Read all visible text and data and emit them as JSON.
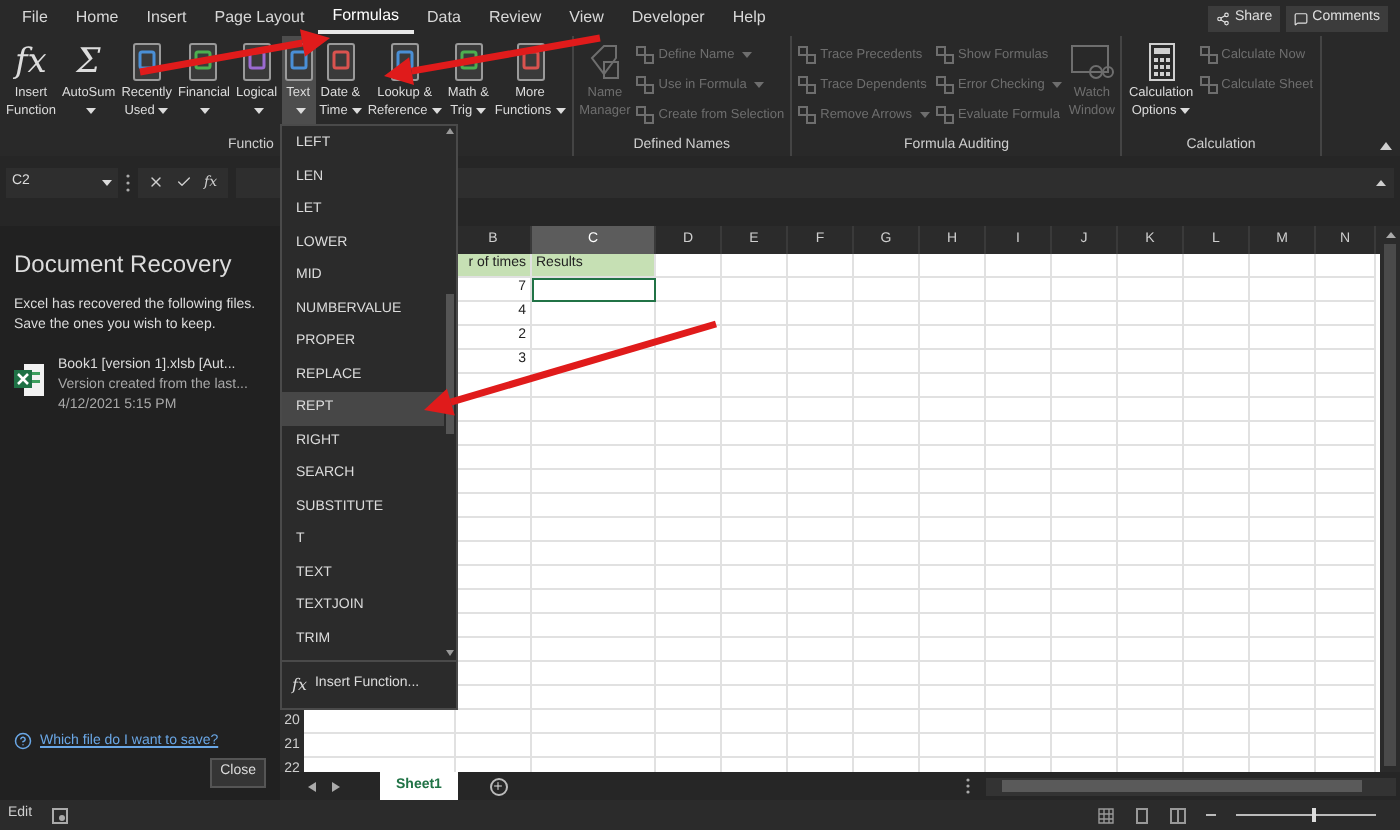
{
  "menu_tabs": [
    {
      "label": "File",
      "selected": false
    },
    {
      "label": "Home",
      "selected": false
    },
    {
      "label": "Insert",
      "selected": false
    },
    {
      "label": "Page Layout",
      "selected": false
    },
    {
      "label": "Formulas",
      "selected": true
    },
    {
      "label": "Data",
      "selected": false
    },
    {
      "label": "Review",
      "selected": false
    },
    {
      "label": "View",
      "selected": false
    },
    {
      "label": "Developer",
      "selected": false
    },
    {
      "label": "Help",
      "selected": false
    }
  ],
  "share_button": "Share",
  "comments_button": "Comments",
  "ribbon_groups": [
    {
      "label": "Functio",
      "buttons": [
        {
          "kind": "large",
          "glyph": "fx",
          "lines": [
            "Insert",
            "Function"
          ],
          "caret": false,
          "selected": false,
          "disabled": false
        },
        {
          "kind": "large",
          "glyph": "Σ",
          "lines": [
            "AutoSum"
          ],
          "caret": true,
          "selected": false,
          "disabled": false
        },
        {
          "kind": "large",
          "lines": [
            "Recently",
            "Used"
          ],
          "caret": true,
          "selected": false,
          "disabled": false
        },
        {
          "kind": "large",
          "lines": [
            "Financial"
          ],
          "caret": true,
          "selected": false,
          "disabled": false
        },
        {
          "kind": "large",
          "lines": [
            "Logical"
          ],
          "caret": true,
          "selected": false,
          "disabled": false
        },
        {
          "kind": "large",
          "lines": [
            "Text"
          ],
          "caret": true,
          "selected": true,
          "disabled": false
        },
        {
          "kind": "large",
          "lines": [
            "Date &",
            "Time"
          ],
          "caret": true,
          "selected": false,
          "disabled": false
        },
        {
          "kind": "large",
          "lines": [
            "Lookup &",
            "Reference"
          ],
          "caret": true,
          "selected": false,
          "disabled": false
        },
        {
          "kind": "large",
          "lines": [
            "Math &",
            "Trig"
          ],
          "caret": true,
          "selected": false,
          "disabled": false
        },
        {
          "kind": "large",
          "lines": [
            "More",
            "Functions"
          ],
          "caret": true,
          "selected": false,
          "disabled": false
        }
      ]
    },
    {
      "label": "Defined Names",
      "buttons": [
        {
          "kind": "large",
          "lines": [
            "Name",
            "Manager"
          ],
          "caret": false,
          "selected": false,
          "disabled": true
        },
        {
          "kind": "small",
          "label": "Define Name",
          "caret": true,
          "selected": false,
          "disabled": true
        },
        {
          "kind": "small",
          "label": "Use in Formula",
          "caret": true,
          "selected": false,
          "disabled": true
        },
        {
          "kind": "small",
          "label": "Create from Selection",
          "caret": false,
          "selected": false,
          "disabled": true
        }
      ]
    },
    {
      "label": "Formula Auditing",
      "buttons": [
        {
          "kind": "small",
          "label": "Trace Precedents",
          "caret": false,
          "selected": false,
          "disabled": true
        },
        {
          "kind": "small",
          "label": "Trace Dependents",
          "caret": false,
          "selected": false,
          "disabled": true
        },
        {
          "kind": "small",
          "label": "Remove Arrows",
          "caret": true,
          "selected": false,
          "disabled": true
        },
        {
          "kind": "small",
          "label": "Show Formulas",
          "caret": false,
          "selected": false,
          "disabled": true
        },
        {
          "kind": "small",
          "label": "Error Checking",
          "caret": true,
          "selected": false,
          "disabled": true
        },
        {
          "kind": "small",
          "label": "Evaluate Formula",
          "caret": false,
          "selected": false,
          "disabled": true
        },
        {
          "kind": "large",
          "lines": [
            "Watch",
            "Window"
          ],
          "caret": false,
          "selected": false,
          "disabled": true
        }
      ]
    },
    {
      "label": "Calculation",
      "buttons": [
        {
          "kind": "large",
          "lines": [
            "Calculation",
            "Options"
          ],
          "caret": true,
          "selected": false,
          "disabled": false
        },
        {
          "kind": "small",
          "label": "Calculate Now",
          "caret": false,
          "selected": false,
          "disabled": true
        },
        {
          "kind": "small",
          "label": "Calculate Sheet",
          "caret": false,
          "selected": false,
          "disabled": true
        }
      ]
    }
  ],
  "formula_bar": {
    "name_box": "C2",
    "function_glyph": "fx"
  },
  "recovery_pane": {
    "title": "Document Recovery",
    "message": "Excel has recovered the following files.  Save the ones you wish to keep.",
    "file": {
      "name": "Book1 [version 1].xlsb  [Aut...",
      "detail": "Version created from the last...",
      "date": "4/12/2021 5:15 PM"
    },
    "help_link": "Which file do I want to save?",
    "close_button": "Close"
  },
  "dropdown": {
    "items": [
      {
        "label": "LEFT",
        "selected": false
      },
      {
        "label": "LEN",
        "selected": false
      },
      {
        "label": "LET",
        "selected": false
      },
      {
        "label": "LOWER",
        "selected": false
      },
      {
        "label": "MID",
        "selected": false
      },
      {
        "label": "NUMBERVALUE",
        "selected": false
      },
      {
        "label": "PROPER",
        "selected": false
      },
      {
        "label": "REPLACE",
        "selected": false
      },
      {
        "label": "REPT",
        "selected": true
      },
      {
        "label": "RIGHT",
        "selected": false
      },
      {
        "label": "SEARCH",
        "selected": false
      },
      {
        "label": "SUBSTITUTE",
        "selected": false
      },
      {
        "label": "T",
        "selected": false
      },
      {
        "label": "TEXT",
        "selected": false
      },
      {
        "label": "TEXTJOIN",
        "selected": false
      },
      {
        "label": "TRIM",
        "selected": false
      }
    ],
    "footer_glyph": "fx",
    "footer": "Insert Function..."
  },
  "grid": {
    "columns": [
      {
        "label": "B",
        "selected": false
      },
      {
        "label": "C",
        "selected": true
      },
      {
        "label": "D",
        "selected": false
      },
      {
        "label": "E",
        "selected": false
      },
      {
        "label": "F",
        "selected": false
      },
      {
        "label": "G",
        "selected": false
      },
      {
        "label": "H",
        "selected": false
      },
      {
        "label": "I",
        "selected": false
      },
      {
        "label": "J",
        "selected": false
      },
      {
        "label": "K",
        "selected": false
      },
      {
        "label": "L",
        "selected": false
      },
      {
        "label": "M",
        "selected": false
      },
      {
        "label": "N",
        "selected": false
      }
    ],
    "header_row": {
      "b": "r of times",
      "c": "Results"
    },
    "rows": [
      {
        "b": "7",
        "c_selected": true
      },
      {
        "b": "4",
        "c_selected": false
      },
      {
        "b": "2",
        "c_selected": false
      },
      {
        "b": "3",
        "c_selected": false
      }
    ],
    "visible_row_numbers": [
      "20",
      "21",
      "22"
    ]
  },
  "sheet_tabs": [
    {
      "label": "Sheet1",
      "selected": true
    }
  ],
  "status_bar": {
    "mode": "Edit",
    "zoom": {
      "level": 0.55
    }
  }
}
